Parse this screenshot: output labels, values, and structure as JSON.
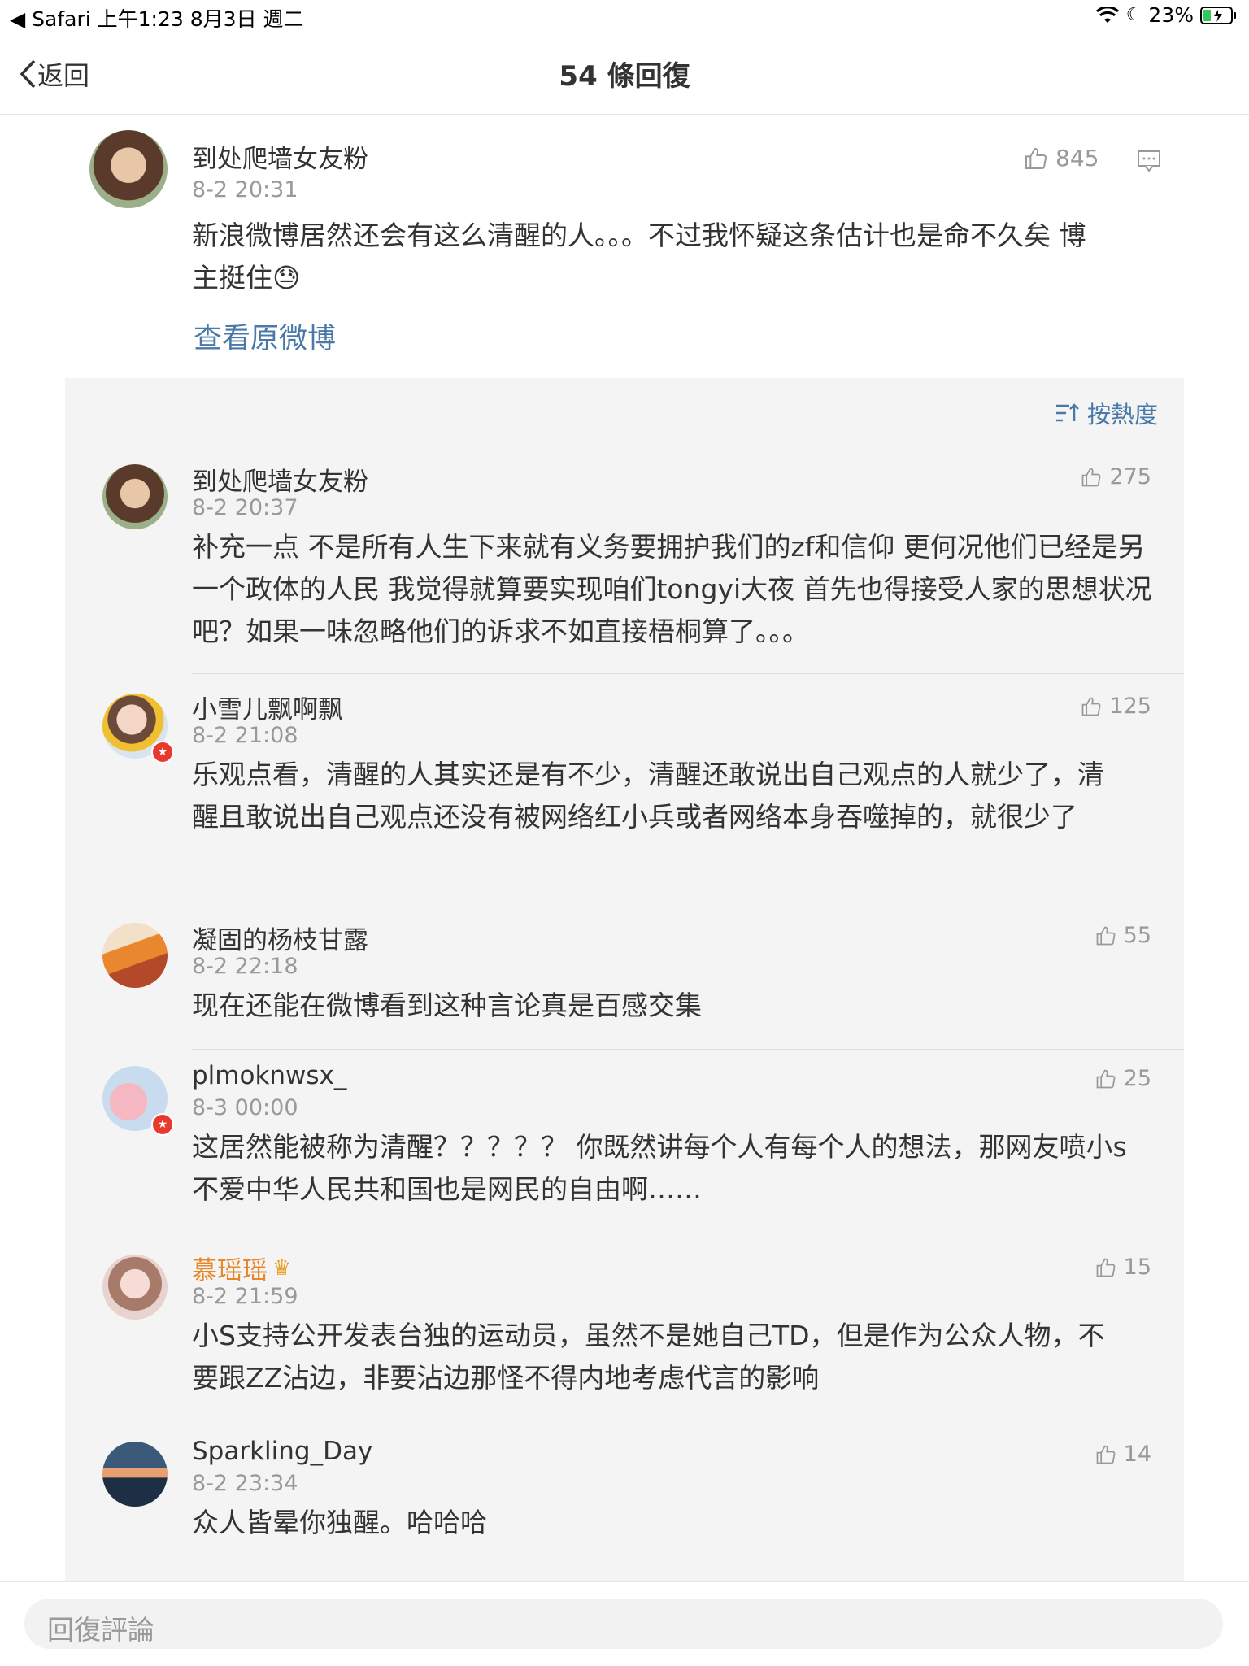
{
  "status": {
    "left": "◀ Safari  上午1:23  8月3日 週二",
    "battery": "23%"
  },
  "nav": {
    "back": "返回",
    "title": "54 條回復"
  },
  "main": {
    "name": "到处爬墙女友粉",
    "time": "8-2 20:31",
    "likes": "845",
    "text": "新浪微博居然还会有这么清醒的人。。。不过我怀疑这条估计也是命不久矣 博主挺住😓",
    "view_original": "查看原微博"
  },
  "sort_label": "按熱度",
  "replies": [
    {
      "name": "到处爬墙女友粉",
      "time": "8-2 20:37",
      "likes": "275",
      "text": "补充一点 不是所有人生下来就有义务要拥护我们的zf和信仰 更何况他们已经是另一个政体的人民 我觉得就算要实现咱们tongyi大夜 首先也得接受人家的思想状况吧？如果一味忽略他们的诉求不如直接梧桐算了。。。"
    },
    {
      "name": "小雪儿飘啊飘",
      "time": "8-2 21:08",
      "likes": "125",
      "text": "乐观点看，清醒的人其实还是有不少，清醒还敢说出自己观点的人就少了，清醒且敢说出自己观点还没有被网络红小兵或者网络本身吞噬掉的，就很少了"
    },
    {
      "name": "凝固的杨枝甘露",
      "time": "8-2 22:18",
      "likes": "55",
      "text": "现在还能在微博看到这种言论真是百感交集"
    },
    {
      "name": "plmoknwsx_",
      "time": "8-3 00:00",
      "likes": "25",
      "text": "这居然能被称为清醒？？？？？ 你既然讲每个人有每个人的想法，那网友喷小s不爱中华人民共和国也是网民的自由啊……"
    },
    {
      "name": "慕瑶瑶",
      "time": "8-2 21:59",
      "likes": "15",
      "text": "小S支持公开发表台独的运动员，虽然不是她自己TD，但是作为公众人物，不要跟ZZ沾边，非要沾边那怪不得内地考虑代言的影响"
    },
    {
      "name": "Sparkling_Day",
      "time": "8-2 23:34",
      "likes": "14",
      "text": "众人皆晕你独醒。哈哈哈"
    }
  ],
  "input_placeholder": "回復評論",
  "colors": {
    "link": "#4a78a8",
    "vip_name": "#e8862a",
    "meta": "#999999",
    "panel": "#f4f4f4"
  }
}
